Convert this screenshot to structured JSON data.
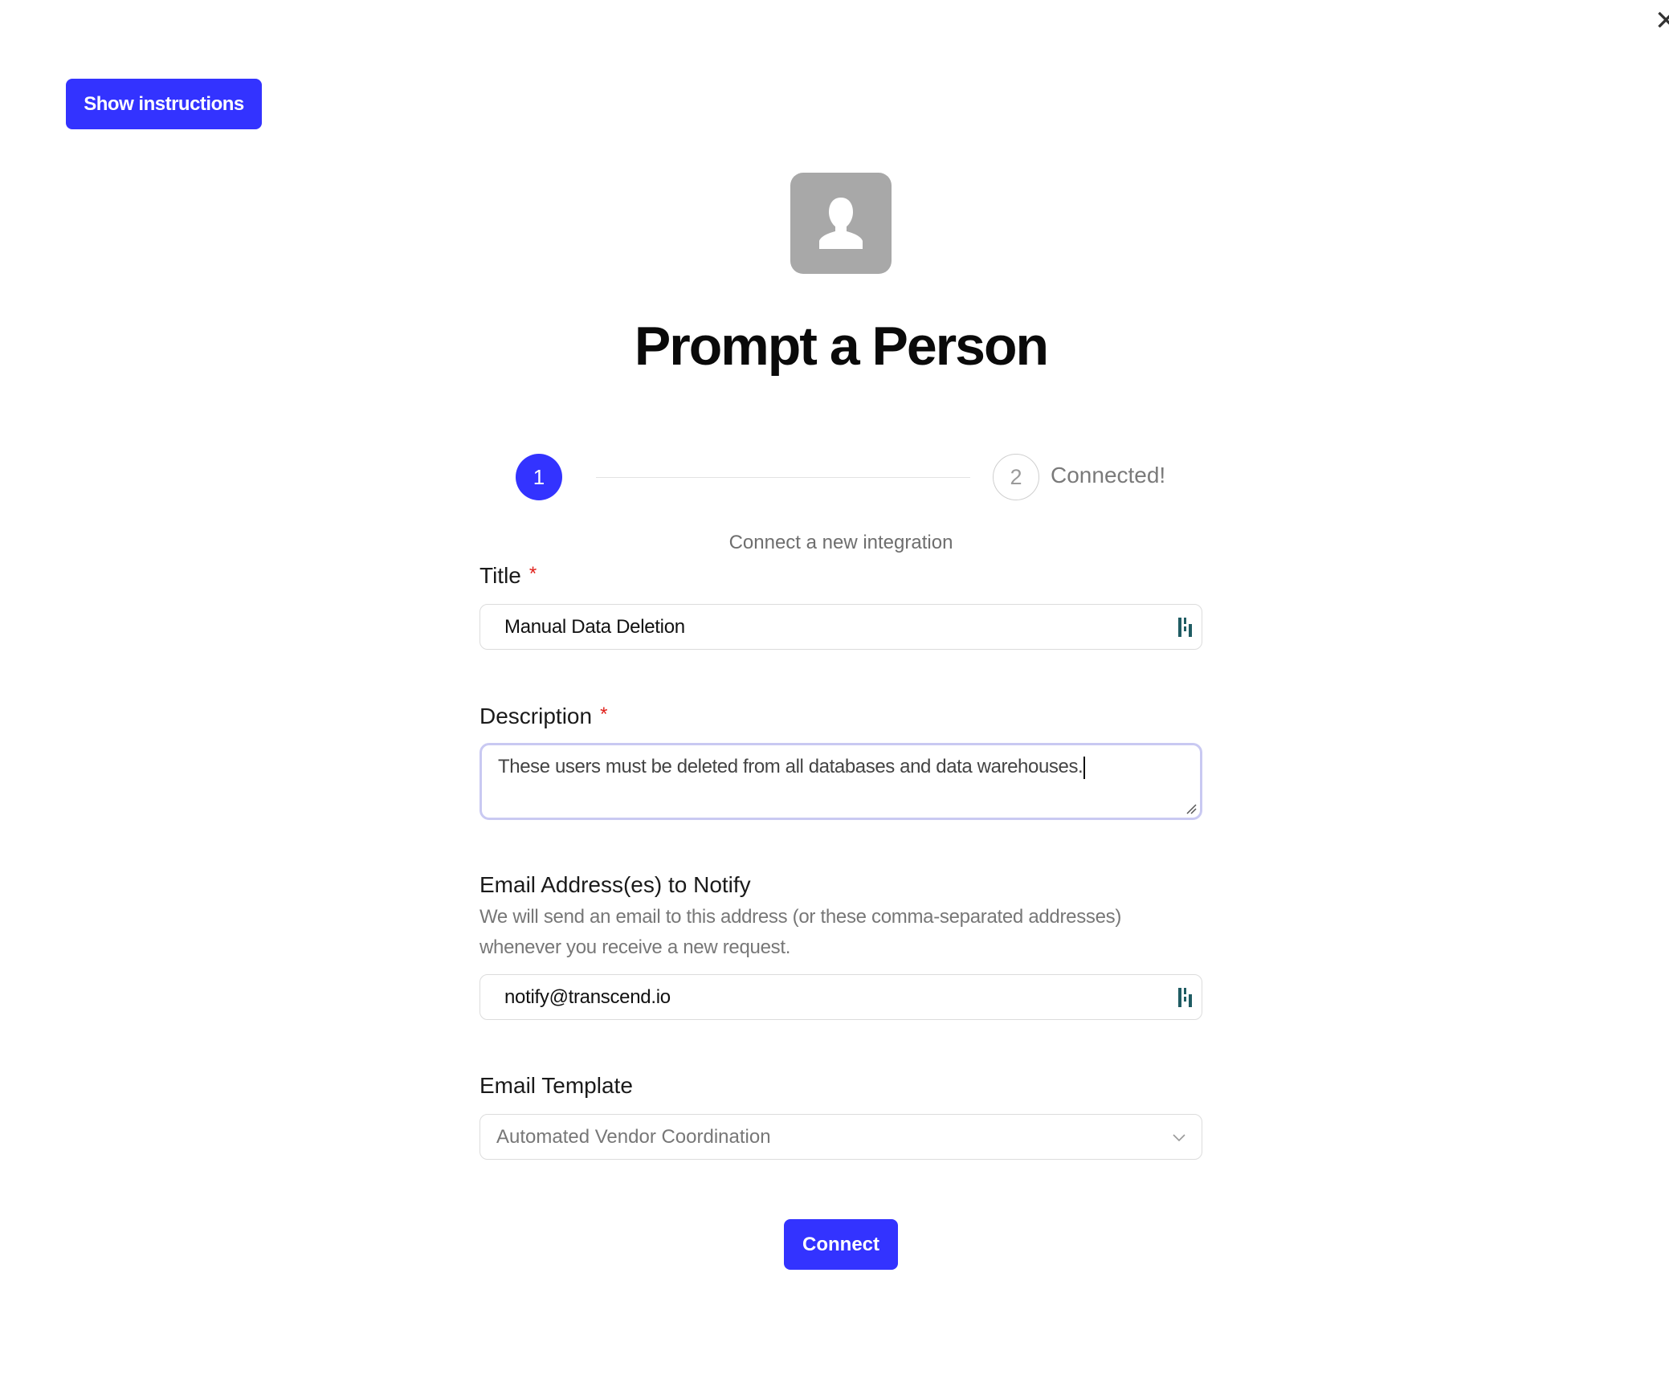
{
  "toolbar": {
    "show_instructions_label": "Show instructions",
    "close_glyph": "✕"
  },
  "header": {
    "title": "Prompt a Person",
    "avatar_icon": "person-icon"
  },
  "stepper": {
    "step1_number": "1",
    "step2_number": "2",
    "step2_label": "Connected!"
  },
  "subtitle": "Connect a new integration",
  "form": {
    "title_field": {
      "label": "Title",
      "required_mark": "*",
      "value": "Manual Data Deletion"
    },
    "description_field": {
      "label": "Description",
      "required_mark": "*",
      "value": "These users must be deleted from all databases and data warehouses."
    },
    "email_field": {
      "label": "Email Address(es) to Notify",
      "help_line1": "We will send an email to this address (or these comma-separated addresses)",
      "help_line2": "whenever you receive a new request.",
      "value": "notify@transcend.io"
    },
    "template_field": {
      "label": "Email Template",
      "selected": "Automated Vendor Coordination"
    },
    "submit_label": "Connect"
  },
  "colors": {
    "primary": "#3333ff",
    "required": "#e0201b",
    "avatar_bg": "#a8a8a8",
    "extension_icon": "#1f5c63"
  }
}
